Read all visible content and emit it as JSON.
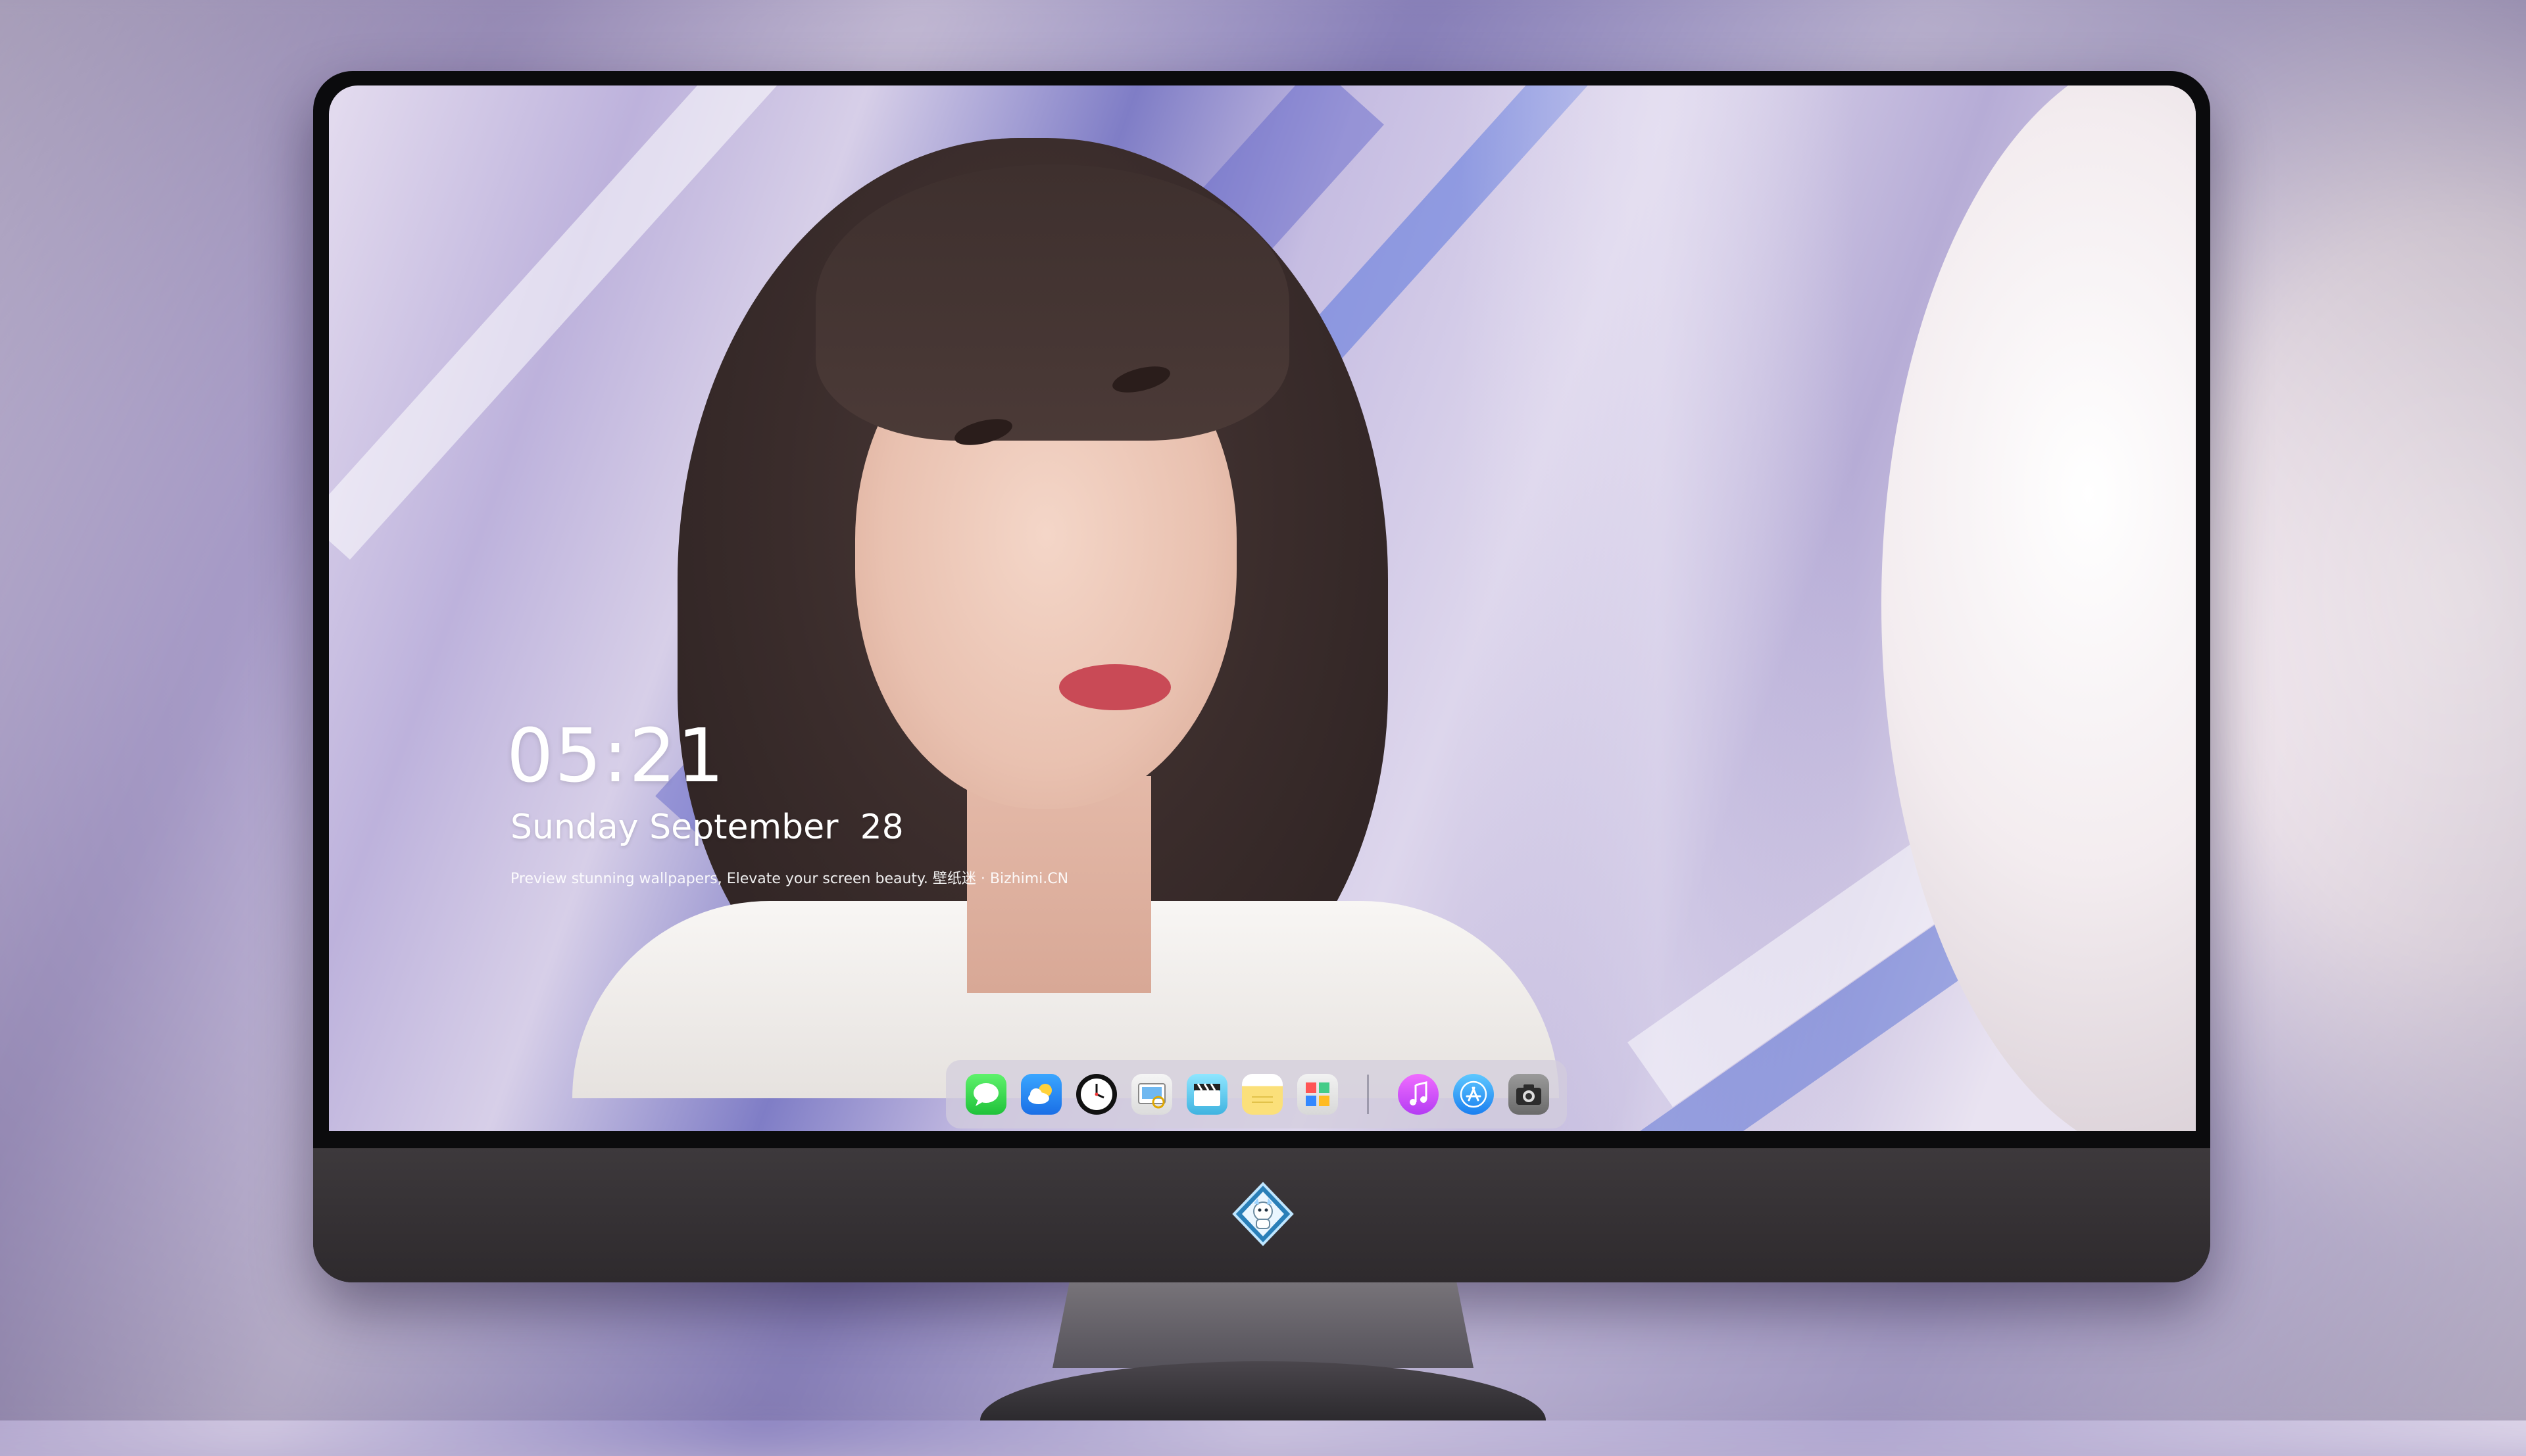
{
  "lockscreen": {
    "time": "05:21",
    "date": "Sunday September  28",
    "tagline": "Preview stunning wallpapers, Elevate your screen beauty. 壁纸迷 · Bizhimi.CN"
  },
  "dock": {
    "apps": [
      {
        "name": "messages",
        "icon": "message-bubble-icon"
      },
      {
        "name": "weather",
        "icon": "weather-cloud-icon"
      },
      {
        "name": "clock",
        "icon": "clock-icon"
      },
      {
        "name": "preview",
        "icon": "preview-icon"
      },
      {
        "name": "clips",
        "icon": "clapperboard-icon"
      },
      {
        "name": "notes",
        "icon": "notes-icon"
      },
      {
        "name": "photo-booth",
        "icon": "photos-icon"
      },
      {
        "name": "itunes",
        "icon": "music-note-icon"
      },
      {
        "name": "app-store",
        "icon": "app-store-icon"
      },
      {
        "name": "camera",
        "icon": "camera-icon"
      }
    ]
  },
  "colors": {
    "wallpaper_accent": "#8e86c2",
    "balloon_red": "#c4142c",
    "monitor_frame": "#0b0b0d"
  }
}
